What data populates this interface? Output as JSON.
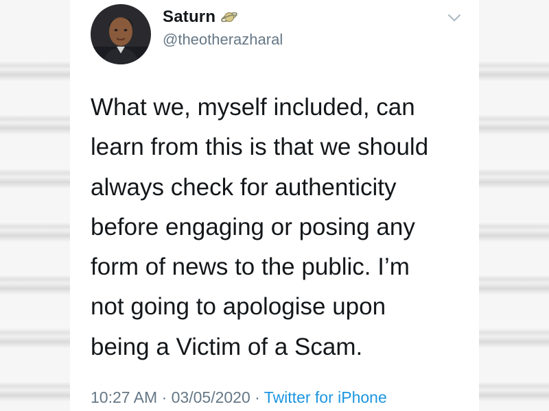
{
  "tweet": {
    "display_name": "Saturn",
    "handle": "@theotherazharal",
    "text": "What we, myself included, can\nlearn from this is that we should\nalways check for authenticity\nbefore engaging or posing any\nform of news to the public. I’m\nnot going to apologise upon\nbeing a Victim of a Scam.",
    "time": "10:27 AM",
    "separator": " · ",
    "date": "03/05/2020",
    "source": "Twitter for iPhone"
  },
  "icons": {
    "name_badge": "saturn-planet-icon",
    "menu": "chevron-down-icon",
    "avatar": "profile-photo"
  },
  "colors": {
    "name": "#14171a",
    "secondary_text": "#657786",
    "link": "#1b95e0",
    "card_background": "#ffffff"
  }
}
